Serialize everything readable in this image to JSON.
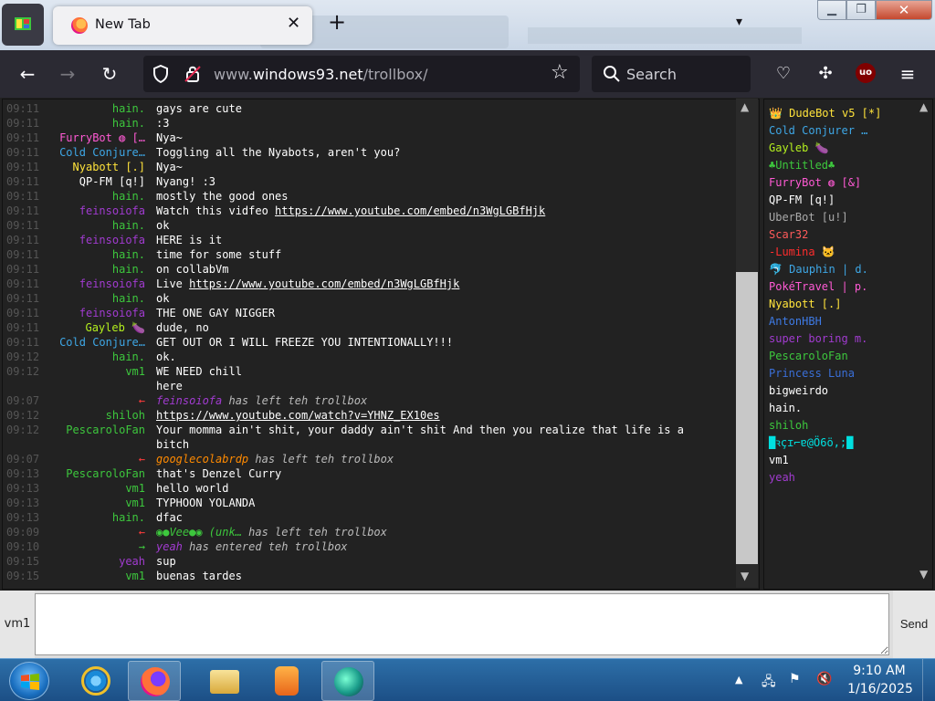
{
  "browser": {
    "tab_title": "New Tab",
    "url_prefix": "www.",
    "url_domain": "windows93.net",
    "url_path": "/trollbox/",
    "search_placeholder": "Search",
    "ublock_badge": "uo"
  },
  "trollbox": {
    "messages": [
      {
        "time": "09:11",
        "nick": "hain.",
        "nick_color": "#3dc73d",
        "text": "gays are cute"
      },
      {
        "time": "09:11",
        "nick": "hain.",
        "nick_color": "#3dc73d",
        "text": ":3"
      },
      {
        "time": "09:11",
        "nick": "FurryBot ◍ […",
        "nick_color": "#ff5ad4",
        "text": "Nya~"
      },
      {
        "time": "09:11",
        "nick": "Cold Conjure…",
        "nick_color": "#3ea7e6",
        "text": "Toggling all the Nyabots, aren't you?"
      },
      {
        "time": "09:11",
        "nick": "Nyabott [.]",
        "nick_color": "#ffe33b",
        "text": "Nya~"
      },
      {
        "time": "09:11",
        "nick": "QP-FM [q!]",
        "nick_color": "#ffffff",
        "text": "Nyang! :3"
      },
      {
        "time": "09:11",
        "nick": "hain.",
        "nick_color": "#3dc73d",
        "text": "mostly the good ones"
      },
      {
        "time": "09:11",
        "nick": "feinsoiofa",
        "nick_color": "#a13bd0",
        "text": "Watch this vidfeo ",
        "link": "https://www.youtube.com/embed/n3WgLGBfHjk"
      },
      {
        "time": "09:11",
        "nick": "hain.",
        "nick_color": "#3dc73d",
        "text": "ok"
      },
      {
        "time": "09:11",
        "nick": "feinsoiofa",
        "nick_color": "#a13bd0",
        "text": "HERE is it"
      },
      {
        "time": "09:11",
        "nick": "hain.",
        "nick_color": "#3dc73d",
        "text": "time for some stuff"
      },
      {
        "time": "09:11",
        "nick": "hain.",
        "nick_color": "#3dc73d",
        "text": "on collabVm"
      },
      {
        "time": "09:11",
        "nick": "feinsoiofa",
        "nick_color": "#a13bd0",
        "text": "Live ",
        "link": "https://www.youtube.com/embed/n3WgLGBfHjk"
      },
      {
        "time": "09:11",
        "nick": "hain.",
        "nick_color": "#3dc73d",
        "text": "ok"
      },
      {
        "time": "09:11",
        "nick": "feinsoiofa",
        "nick_color": "#a13bd0",
        "text": "THE ONE GAY NIGGER"
      },
      {
        "time": "09:11",
        "nick": "Gayleb 🍆",
        "nick_color": "#b4f01e",
        "text": "dude, no"
      },
      {
        "time": "09:11",
        "nick": "Cold Conjure…",
        "nick_color": "#3ea7e6",
        "text": "GET OUT OR I WILL FREEZE YOU INTENTIONALLY!!!"
      },
      {
        "time": "09:12",
        "nick": "hain.",
        "nick_color": "#3dc73d",
        "text": "ok."
      },
      {
        "time": "09:12",
        "nick": "vm1",
        "nick_color": "#3dc73d",
        "text": "WE NEED chill"
      },
      {
        "time": "",
        "nick": "",
        "nick_color": "#3dc73d",
        "text": "here"
      },
      {
        "time": "09:07",
        "nick": "←",
        "nick_color": "#ff3b3b",
        "sys_nick": "feinsoiofa",
        "sys_color": "#a13bd0",
        "text": " has left teh trollbox",
        "sys": true
      },
      {
        "time": "09:12",
        "nick": "shiloh",
        "nick_color": "#3dc73d",
        "text": "",
        "link": "https://www.youtube.com/watch?v=YHNZ_EX10es"
      },
      {
        "time": "09:12",
        "nick": "PescaroloFan",
        "nick_color": "#3dc73d",
        "text": "Your momma ain't shit, your daddy ain't shit And then you realize that life is a"
      },
      {
        "time": "",
        "nick": "",
        "nick_color": "#3dc73d",
        "text": "bitch"
      },
      {
        "time": "09:07",
        "nick": "←",
        "nick_color": "#ff3b3b",
        "sys_nick": "googlecolabrdp",
        "sys_color": "#ff8a00",
        "text": " has left teh trollbox",
        "sys": true
      },
      {
        "time": "09:13",
        "nick": "PescaroloFan",
        "nick_color": "#3dc73d",
        "text": "that's Denzel Curry"
      },
      {
        "time": "09:13",
        "nick": "vm1",
        "nick_color": "#3dc73d",
        "text": "hello world"
      },
      {
        "time": "09:13",
        "nick": "vm1",
        "nick_color": "#3dc73d",
        "text": "TYPHOON YOLANDA"
      },
      {
        "time": "09:13",
        "nick": "hain.",
        "nick_color": "#3dc73d",
        "text": "dfac"
      },
      {
        "time": "09:09",
        "nick": "←",
        "nick_color": "#ff3b3b",
        "sys_nick": "◉●Vee●◉ (unk…",
        "sys_color": "#3dc73d",
        "text": " has left teh trollbox",
        "sys": true
      },
      {
        "time": "09:10",
        "nick": "→",
        "nick_color": "#3dc73d",
        "sys_nick": "yeah",
        "sys_color": "#a13bd0",
        "text": " has entered teh trollbox",
        "sys": true
      },
      {
        "time": "09:15",
        "nick": "yeah",
        "nick_color": "#a13bd0",
        "text": "sup"
      },
      {
        "time": "09:15",
        "nick": "vm1",
        "nick_color": "#3dc73d",
        "text": "buenas tardes"
      }
    ],
    "users": [
      {
        "name": "👑 DudeBot v5 [*]",
        "color": "#ffe33b"
      },
      {
        "name": "Cold Conjurer …",
        "color": "#3ea7e6"
      },
      {
        "name": "Gayleb 🍆",
        "color": "#b4f01e"
      },
      {
        "name": "♣Untitled♣",
        "color": "#3dc73d"
      },
      {
        "name": "FurryBot ◍ [&]",
        "color": "#ff5ad4"
      },
      {
        "name": "QP-FM [q!]",
        "color": "#ffffff"
      },
      {
        "name": "UberBot [u!]",
        "color": "#aaaaaa"
      },
      {
        "name": "Scar32",
        "color": "#ff5a5a"
      },
      {
        "name": "-Lumina 🐱",
        "color": "#ff2d2d"
      },
      {
        "name": "🐬 Dauphin | d.",
        "color": "#3ea7e6"
      },
      {
        "name": "PokéTravel | p.",
        "color": "#ff5ad4"
      },
      {
        "name": "Nyabott [.]",
        "color": "#ffe33b"
      },
      {
        "name": "AntonHBH",
        "color": "#3e7be6"
      },
      {
        "name": "super boring m.",
        "color": "#a13bd0"
      },
      {
        "name": "PescaroloFan",
        "color": "#3dc73d"
      },
      {
        "name": "Princess Luna",
        "color": "#3a6fd8"
      },
      {
        "name": "bigweirdo",
        "color": "#ffffff"
      },
      {
        "name": "hain.",
        "color": "#ffffff"
      },
      {
        "name": "shiloh",
        "color": "#3dc73d"
      },
      {
        "name": "█ꝛçɪ⌐ɐ@Ö6ö,;█",
        "color": "#00e0e0"
      },
      {
        "name": "vm1",
        "color": "#ffffff"
      },
      {
        "name": "yeah",
        "color": "#a13bd0"
      }
    ],
    "nick_label": "vm1",
    "input_value": "",
    "send_label": "Send"
  },
  "taskbar": {
    "time": "9:10 AM",
    "date": "1/16/2025"
  }
}
